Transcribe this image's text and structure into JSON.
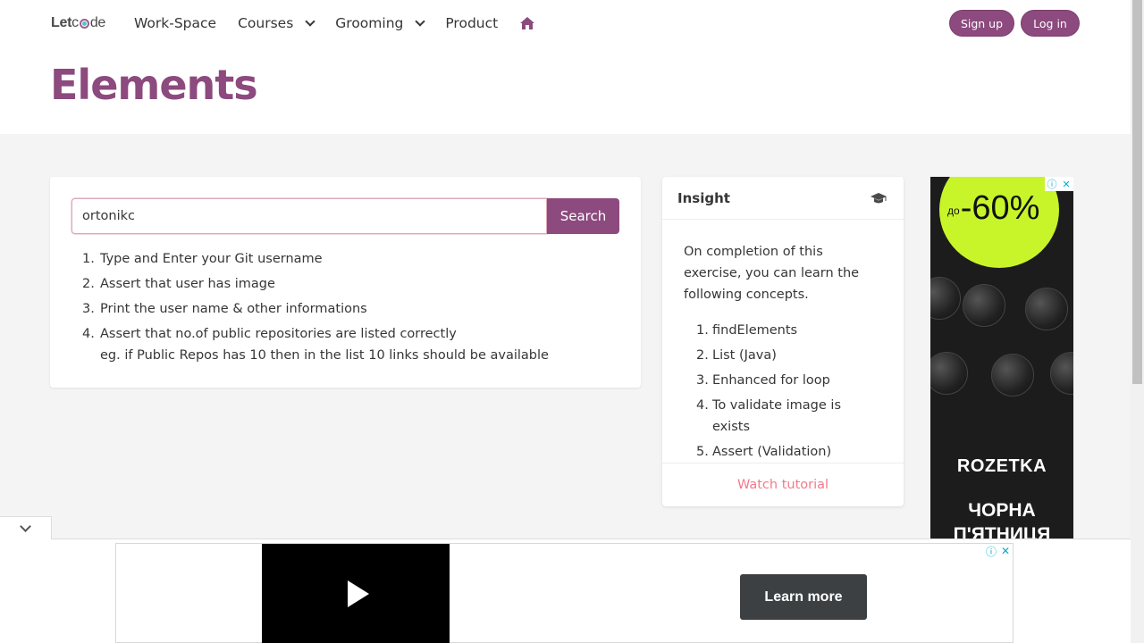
{
  "brand": {
    "prefix": "Let",
    "suffix": "de"
  },
  "nav": {
    "items": [
      "Work-Space",
      "Courses",
      "Grooming",
      "Product"
    ],
    "signup_label": "Sign up",
    "login_label": "Log in"
  },
  "page": {
    "title": "Elements"
  },
  "search": {
    "value": "ortonikc",
    "button_label": "Search"
  },
  "steps": [
    {
      "num": "1.",
      "text": "Type and Enter your Git username"
    },
    {
      "num": "2.",
      "text": "Assert that user has image"
    },
    {
      "num": "3.",
      "text": "Print the user name & other informations"
    },
    {
      "num": "4.",
      "text": "Assert that no.of public repositories are listed correctly",
      "sub": "eg. if Public Repos has 10 then in the list 10 links should be available"
    }
  ],
  "insight": {
    "title": "Insight",
    "intro": "On completion of this exercise, you can learn the following concepts.",
    "concepts": [
      {
        "num": "1.",
        "text": "findElements"
      },
      {
        "num": "2.",
        "text": "List (Java)"
      },
      {
        "num": "3.",
        "text": "Enhanced for loop"
      },
      {
        "num": "4.",
        "text": "To validate image is exists"
      },
      {
        "num": "5.",
        "text": "Assert (Validation)"
      }
    ],
    "footer_link": "Watch tutorial"
  },
  "side_ad": {
    "promo_prefix": "до",
    "promo_value": "-60%",
    "brand": "ROZETKA",
    "headline_line1": "ЧОРНА",
    "headline_line2": "П'ЯТНИЦЯ"
  },
  "bottom_ad": {
    "cta_label": "Learn more"
  },
  "colors": {
    "brand": "#8c4a7e",
    "link": "#f27a8c",
    "background": "#f4f4f4"
  }
}
